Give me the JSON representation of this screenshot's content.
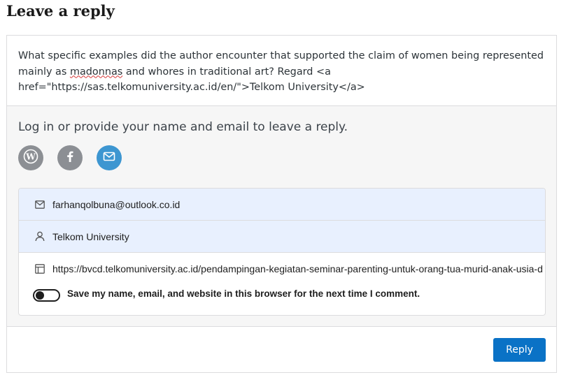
{
  "heading": "Leave a reply",
  "comment": {
    "line1": "What specific examples did the author encounter that supported the claim of women being represented",
    "line2_pre": "mainly as ",
    "line2_misspelled": "madonnas",
    "line2_post": " and whores in traditional art? Regard <a",
    "line3": "href=\"https://sas.telkomuniversity.ac.id/en/\">Telkom University</a>"
  },
  "login": {
    "prompt": "Log in or provide your name and email to leave a reply.",
    "options": [
      "wordpress-icon",
      "facebook-icon",
      "mail-icon"
    ]
  },
  "fields": {
    "email": "farhanqolbuna@outlook.co.id",
    "name": "Telkom University",
    "website": "https://bvcd.telkomuniversity.ac.id/pendampingan-kegiatan-seminar-parenting-untuk-orang-tua-murid-anak-usia-d"
  },
  "save_label": "Save my name, email, and website in this browser for the next time I comment.",
  "reply_label": "Reply",
  "colors": {
    "reply_button": "#0a72c6",
    "mail_button": "#3d96d1",
    "social_button": "#8c8f94",
    "autofill_bg": "#e8f0fe"
  }
}
